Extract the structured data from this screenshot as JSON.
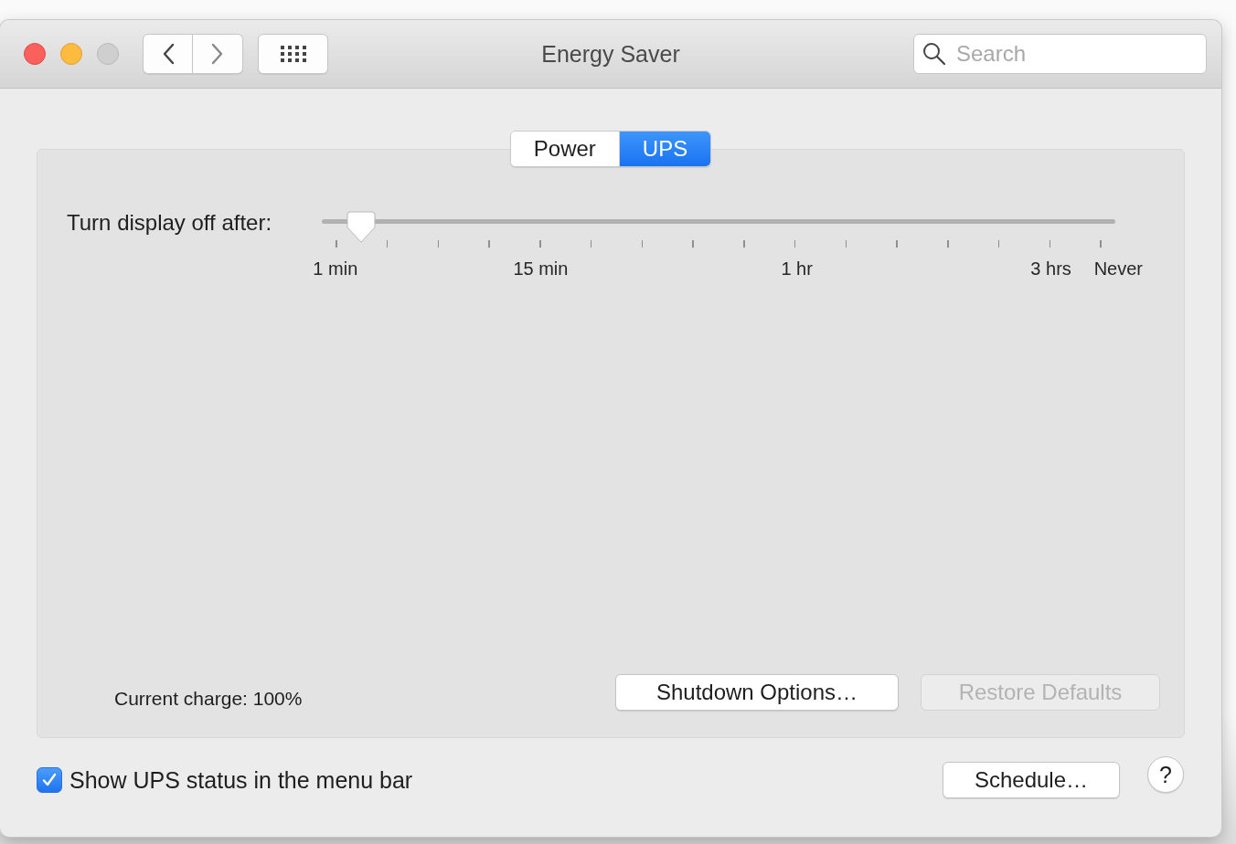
{
  "window": {
    "title": "Energy Saver",
    "search": {
      "placeholder": "Search"
    }
  },
  "tabs": [
    {
      "label": "Power",
      "selected": false
    },
    {
      "label": "UPS",
      "selected": true
    }
  ],
  "display_sleep": {
    "label": "Turn display off after:",
    "level": 0.033,
    "tick_labels": [
      "1 min",
      "15 min",
      "1 hr",
      "3 hrs",
      "Never"
    ]
  },
  "current_charge": "Current charge: 100%",
  "buttons": [
    {
      "label": "Shutdown Options…",
      "disabled": false
    },
    {
      "label": "Restore Defaults",
      "disabled": true
    }
  ],
  "show_status": {
    "label": "Show UPS status in the menu bar",
    "checked": true
  },
  "schedule_button": "Schedule…",
  "help_button": "?"
}
